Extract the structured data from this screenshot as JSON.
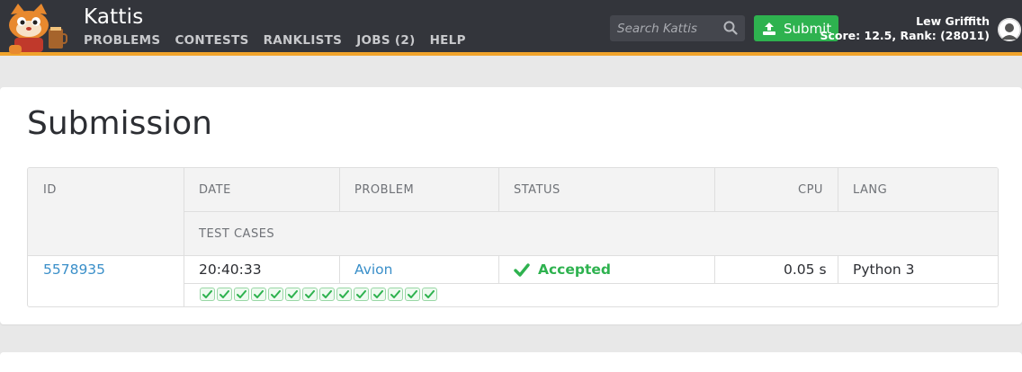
{
  "header": {
    "brand": "Kattis",
    "nav": [
      "PROBLEMS",
      "CONTESTS",
      "RANKLISTS",
      "JOBS (2)",
      "HELP"
    ],
    "search_placeholder": "Search Kattis",
    "submit_label": "Submit",
    "user_name": "Lew Griffith",
    "user_score": "Score: 12.5, Rank: (28011)",
    "accent_color": "#f0a32b",
    "submit_color": "#2eb24f"
  },
  "page": {
    "title": "Submission"
  },
  "table": {
    "headers": {
      "id": "ID",
      "date": "DATE",
      "problem": "PROBLEM",
      "status": "STATUS",
      "cpu": "CPU",
      "lang": "LANG",
      "test_cases": "TEST CASES"
    },
    "row": {
      "id": "5578935",
      "date": "20:40:33",
      "problem": "Avion",
      "status": "Accepted",
      "cpu": "0.05 s",
      "lang": "Python 3",
      "test_case_results": [
        "accepted",
        "accepted",
        "accepted",
        "accepted",
        "accepted",
        "accepted",
        "accepted",
        "accepted",
        "accepted",
        "accepted",
        "accepted",
        "accepted",
        "accepted",
        "accepted"
      ]
    },
    "status_color": "#2eb24f",
    "link_color": "#3a8fc9"
  }
}
